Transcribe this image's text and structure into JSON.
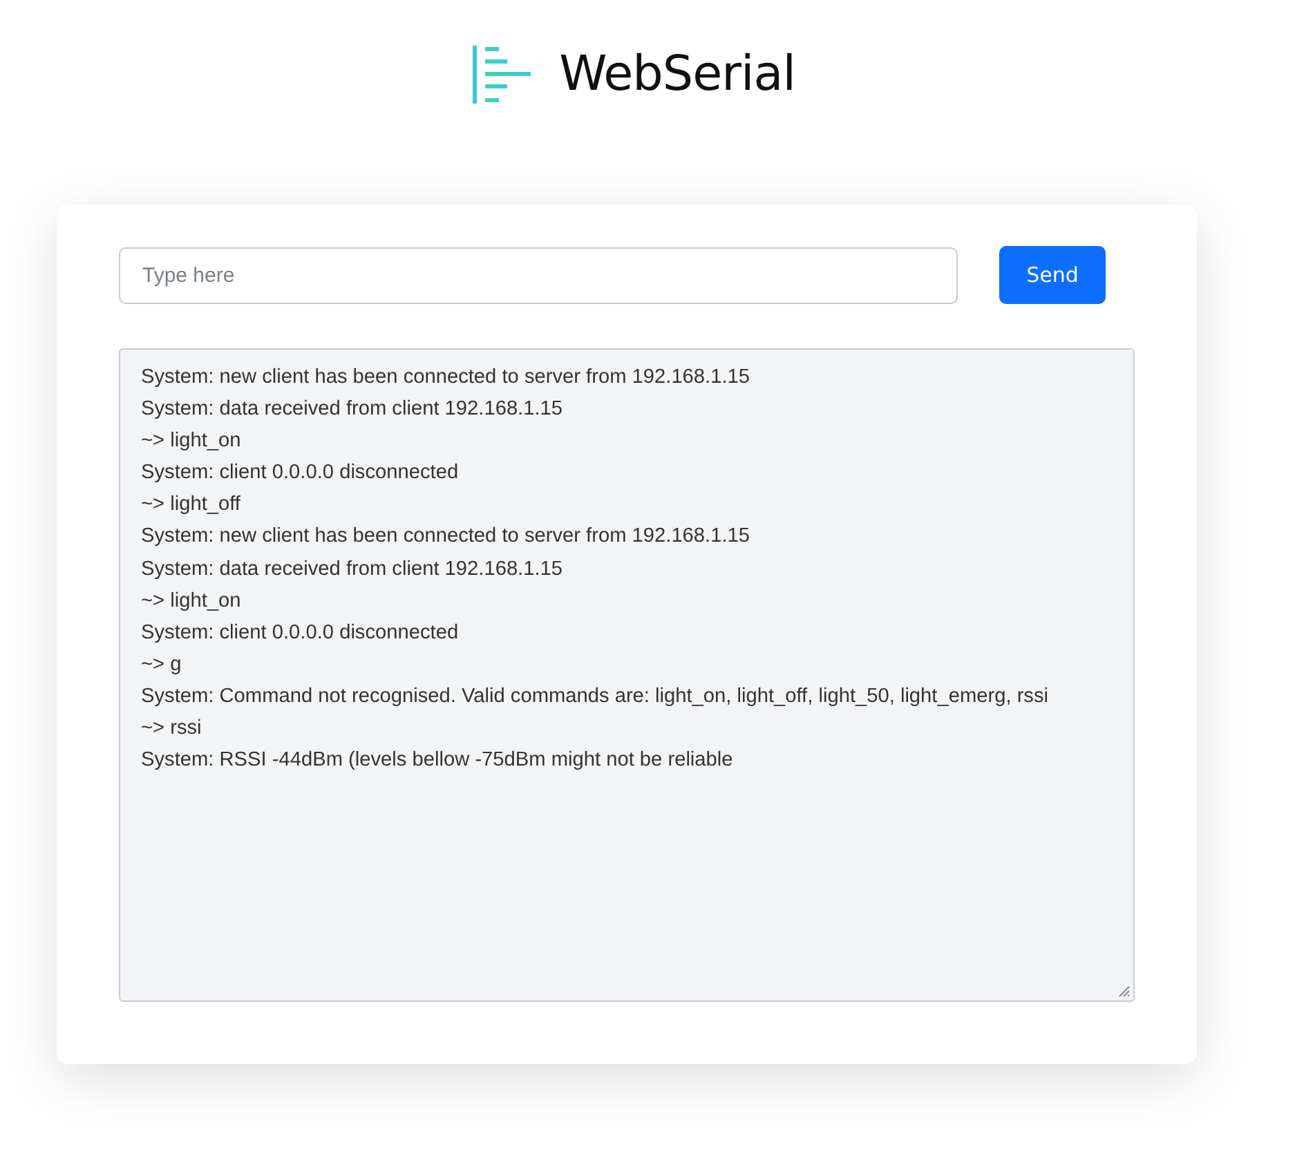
{
  "brand": {
    "title": "WebSerial"
  },
  "input": {
    "placeholder": "Type here"
  },
  "send_button": {
    "label": "Send"
  },
  "log": {
    "lines": [
      "System: new client has been connected to server from 192.168.1.15",
      "System: data received from client 192.168.1.15",
      "~> light_on",
      "System: client 0.0.0.0 disconnected",
      "~> light_off",
      "System: new client has been connected to server from 192.168.1.15",
      "System: data received from client 192.168.1.15",
      "~> light_on",
      "System: client 0.0.0.0 disconnected",
      "~> g",
      "System: Command not recognised. Valid commands are: light_on, light_off, light_50, light_emerg, rssi",
      "~> rssi",
      "System: RSSI -44dBm (levels bellow -75dBm might not be reliable"
    ]
  }
}
